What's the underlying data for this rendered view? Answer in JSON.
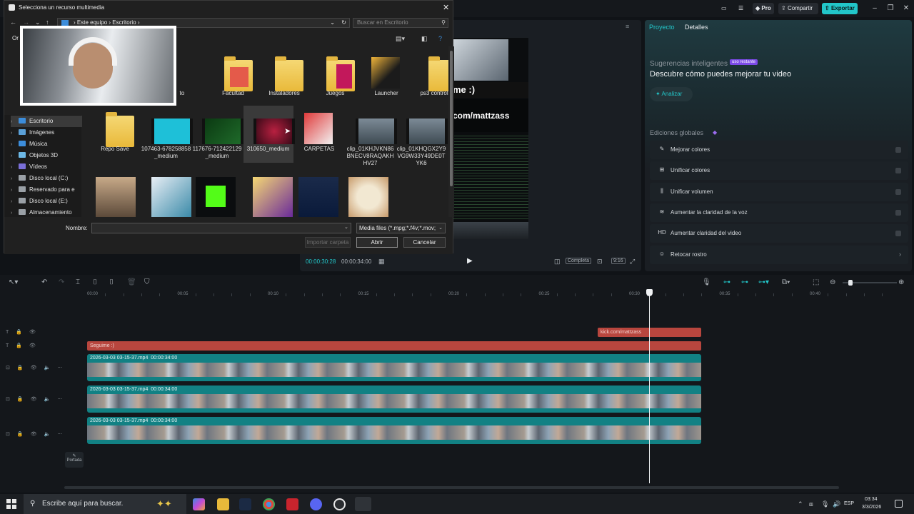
{
  "editor": {
    "pro_label": "Pro",
    "share_label": "Compartir",
    "export_label": "Exportar",
    "accent": "#22c6c9"
  },
  "preview": {
    "overlay_slogan": "me :)",
    "overlay_url": "com/mattzass",
    "time_current": "00:00:30:28",
    "time_total": "00:00:34:00",
    "full_label": "Completa",
    "ratio_label": "9:16"
  },
  "right_panel": {
    "tabs": [
      "Proyecto",
      "Detalles"
    ],
    "smart_label": "Sugerencias inteligentes",
    "smart_badge": "uso restante",
    "smart_title": "Descubre cómo puedes mejorar tu video",
    "analyze_label": "Analizar",
    "global_label": "Ediciones globales",
    "global_edits": [
      {
        "label": "Mejorar colores",
        "icon": "magic-wand-icon",
        "glyph": "✎"
      },
      {
        "label": "Unificar colores",
        "icon": "color-match-icon",
        "glyph": "⊞"
      },
      {
        "label": "Unificar volumen",
        "icon": "volume-bars-icon",
        "glyph": "⫼"
      },
      {
        "label": "Aumentar la claridad de la voz",
        "icon": "voice-wave-icon",
        "glyph": "≋"
      },
      {
        "label": "Aumentar claridad del video",
        "icon": "hd-icon",
        "glyph": "HD"
      },
      {
        "label": "Retocar rostro",
        "icon": "face-icon",
        "glyph": "☺"
      }
    ]
  },
  "timeline": {
    "ticks": [
      "00:00",
      "00:05",
      "00:10",
      "00:15",
      "00:20",
      "00:25",
      "00:30",
      "00:35",
      "00:40"
    ],
    "text_clip_1": "kick.com/mattzass",
    "text_clip_2": "Seguime :)",
    "video_clips": [
      {
        "name": "2026-03-03 03-15-37.mp4",
        "duration": "00:00:34:00"
      },
      {
        "name": "2026-03-03 03-15-37.mp4",
        "duration": "00:00:34:00"
      },
      {
        "name": "2026-03-03 03-15-37.mp4",
        "duration": "00:00:34:00"
      }
    ],
    "cover_label": "Portada",
    "playhead_fraction": 0.898
  },
  "dialog": {
    "title": "Selecciona un recurso multimedia",
    "address_root": "Este equipo",
    "address_folder": "Escritorio",
    "search_placeholder": "Buscar en Escritorio",
    "organize_label": "Or",
    "tree": [
      {
        "label": "Escritorio",
        "icon": "desktop-icon",
        "color": "#3c8ddb",
        "selected": true
      },
      {
        "label": "Imágenes",
        "icon": "pictures-icon",
        "color": "#5aa0d8",
        "selected": false
      },
      {
        "label": "Música",
        "icon": "music-icon",
        "color": "#3c8ddb",
        "selected": false
      },
      {
        "label": "Objetos 3D",
        "icon": "objects3d-icon",
        "color": "#6cb8e6",
        "selected": false
      },
      {
        "label": "Vídeos",
        "icon": "videos-icon",
        "color": "#7a6fd8",
        "selected": false
      },
      {
        "label": "Disco local (C:)",
        "icon": "drive-icon",
        "color": "#9aa0a6",
        "selected": false
      },
      {
        "label": "Reservado para e",
        "icon": "drive-icon",
        "color": "#9aa0a6",
        "selected": false
      },
      {
        "label": "Disco local (E:)",
        "icon": "drive-icon",
        "color": "#9aa0a6",
        "selected": false
      },
      {
        "label": "Almacenamiento",
        "icon": "drive-icon",
        "color": "#9aa0a6",
        "selected": false
      }
    ],
    "files_row1": [
      {
        "name": "to",
        "kind": "partial"
      },
      {
        "name": "Facultad",
        "kind": "pdf-folder"
      },
      {
        "name": "Instaladores",
        "kind": "folder"
      },
      {
        "name": "Juegos",
        "kind": "game-folder"
      },
      {
        "name": "Launcher",
        "kind": "launcher"
      },
      {
        "name": "ps3 controller",
        "kind": "folder"
      }
    ],
    "files_row2": [
      {
        "name": "Repo Save",
        "kind": "folder"
      },
      {
        "name": "107463-678258858_medium",
        "kind": "video-cyan"
      },
      {
        "name": "117676-712422129_medium",
        "kind": "video-green"
      },
      {
        "name": "310650_medium",
        "kind": "video-red",
        "selected": true
      },
      {
        "name": "CARPETAS",
        "kind": "carpetas"
      },
      {
        "name": "clip_01KHJVKN86BNECV8RAQAKHHV27",
        "kind": "video-game"
      },
      {
        "name": "clip_01KHQGX2Y9VG9W33Y49DE0TYK6",
        "kind": "video-game"
      }
    ],
    "name_label": "Nombre:",
    "name_value": "",
    "type_value": "Media files (*.mpg;*.f4v;*.mov;",
    "import_label": "Importar carpeta",
    "open_label": "Abrir",
    "cancel_label": "Cancelar"
  },
  "taskbar": {
    "search_placeholder": "Escribe aquí para buscar.",
    "language": "ESP",
    "time": "03:34",
    "date": "3/3/2026"
  }
}
